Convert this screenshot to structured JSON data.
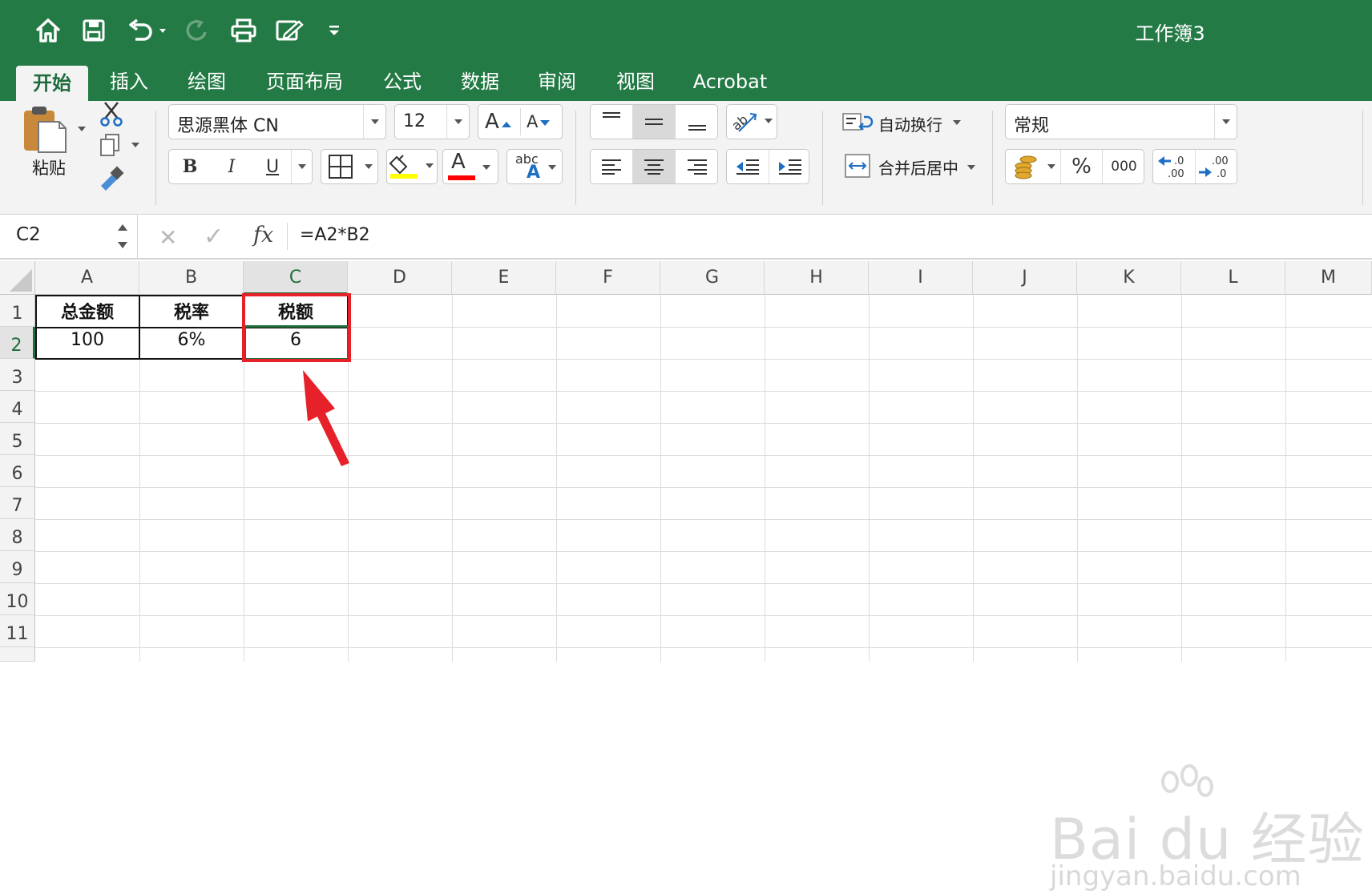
{
  "window": {
    "title": "工作簿3"
  },
  "quick_access": [
    {
      "icon": "home-icon"
    },
    {
      "icon": "save-icon"
    },
    {
      "icon": "undo-icon"
    },
    {
      "icon": "redo-icon"
    },
    {
      "icon": "print-icon"
    },
    {
      "icon": "edit-icon"
    },
    {
      "icon": "customize-icon"
    }
  ],
  "tabs": [
    "开始",
    "插入",
    "绘图",
    "页面布局",
    "公式",
    "数据",
    "审阅",
    "视图",
    "Acrobat"
  ],
  "ribbon": {
    "paste_label": "粘贴",
    "font_name": "思源黑体 CN",
    "font_size": "12",
    "bold": "B",
    "italic": "I",
    "underline": "U",
    "font_color_glyph": "A",
    "abc_glyph": "abc",
    "wrap_text": "自动换行",
    "merge_center": "合并后居中",
    "number_format": "常规",
    "percent": "%",
    "thousands": "000",
    "inc_decimal": ".0\n.00",
    "dec_decimal": ".00\n.0",
    "grow_font": "A",
    "shrink_font": "A",
    "fill_color": "#ffff00",
    "font_color": "#ff0000"
  },
  "formula_bar": {
    "name_box": "C2",
    "cancel": "✕",
    "confirm": "✓",
    "fx": "fx",
    "formula": "=A2*B2"
  },
  "sheet": {
    "columns": [
      "A",
      "B",
      "C",
      "D",
      "E",
      "F",
      "G",
      "H",
      "I",
      "J",
      "K",
      "L",
      "M"
    ],
    "rows": [
      "1",
      "2",
      "3",
      "4",
      "5",
      "6",
      "7",
      "8",
      "9",
      "10",
      "11"
    ],
    "selected_cell": "C2",
    "cells": {
      "A1": "总金额",
      "B1": "税率",
      "C1": "税额",
      "A2": "100",
      "B2": "6%",
      "C2": "6"
    }
  },
  "annotation": {
    "color": "#e62129"
  },
  "watermark": {
    "line1": "Bai du 经验",
    "line2": "jingyan.baidu.com"
  }
}
